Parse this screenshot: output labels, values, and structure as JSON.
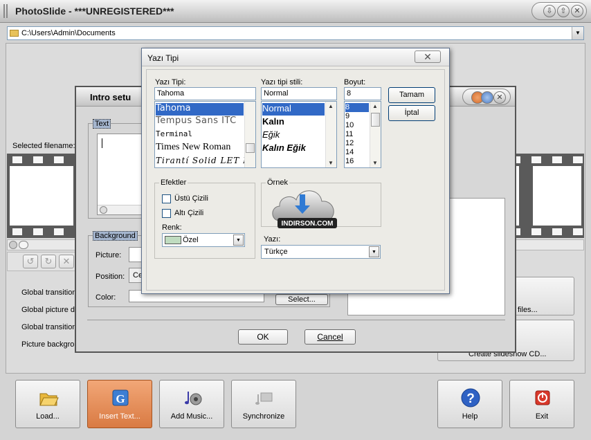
{
  "app": {
    "title": "PhotoSlide - ***UNREGISTERED***",
    "path": "C:\\Users\\Admin\\Documents",
    "selected_filename_label": "Selected filename:",
    "settings_labels": [
      "Global transition",
      "Global picture d",
      "Global transition",
      "Picture backgro"
    ],
    "right_buttons": [
      "w files...",
      "Create slideshow CD..."
    ],
    "toolbar": [
      {
        "label": "Load...",
        "icon": "folder-open-icon"
      },
      {
        "label": "Insert Text...",
        "icon": "insert-text-icon"
      },
      {
        "label": "Add Music...",
        "icon": "music-icon"
      },
      {
        "label": "Synchronize",
        "icon": "synchronize-icon"
      },
      {
        "label": "Help",
        "icon": "help-icon"
      },
      {
        "label": "Exit",
        "icon": "exit-icon"
      }
    ]
  },
  "intro": {
    "title": "Intro setu",
    "text_group": "Text",
    "background_group": "Background",
    "picture_label": "Picture:",
    "position_label": "Position:",
    "position_value": "Ce",
    "color_label": "Color:",
    "select_button": "Select...",
    "ok_button": "OK",
    "cancel_button": "Cancel"
  },
  "font_dialog": {
    "title": "Yazı Tipi",
    "font_label": "Yazı Tipi:",
    "style_label": "Yazı tipi stili:",
    "size_label": "Boyut:",
    "font_value": "Tahoma",
    "style_value": "Normal",
    "size_value": "8",
    "fonts": [
      "Tahoma",
      "Tempus Sans ITC",
      "Terminal",
      "Times New Roman",
      "Tirantí Solid LET Plain"
    ],
    "styles": [
      "Normal",
      "Kalın",
      "Eğik",
      "Kalın Eğik"
    ],
    "sizes": [
      "8",
      "9",
      "10",
      "11",
      "12",
      "14",
      "16"
    ],
    "ok_button": "Tamam",
    "cancel_button": "İptal",
    "effects_group": "Efektler",
    "strikeout_label": "Üstü Çizili",
    "underline_label": "Altı Çizili",
    "color_label": "Renk:",
    "color_value": "Özel",
    "color_swatch": "#c0dcc0",
    "sample_group": "Örnek",
    "watermark_text": "INDIRSON.COM",
    "script_label": "Yazı:",
    "script_value": "Türkçe"
  }
}
